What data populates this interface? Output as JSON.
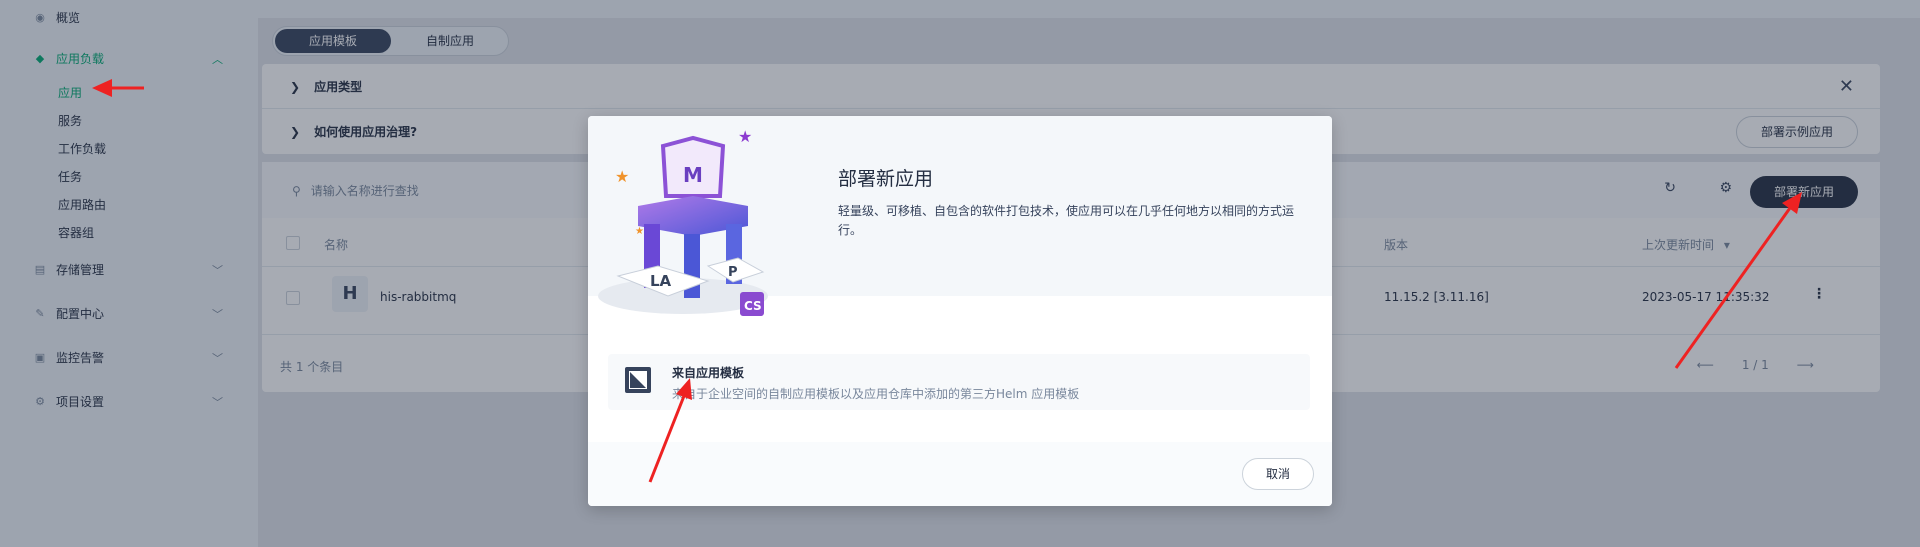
{
  "sidebar": {
    "overview": "概览",
    "workloads_group": "应用负载",
    "workloads_items": [
      "应用",
      "服务",
      "工作负载",
      "任务",
      "应用路由",
      "容器组"
    ],
    "storage": "存储管理",
    "config": "配置中心",
    "monitoring": "监控告警",
    "project_settings": "项目设置"
  },
  "tabs": {
    "templates": "应用模板",
    "custom": "自制应用"
  },
  "info": {
    "app_types": "应用类型",
    "how_to": "如何使用应用治理?",
    "sample_button": "部署示例应用"
  },
  "list": {
    "search_placeholder": "请输入名称进行查找",
    "deploy_button": "部署新应用",
    "col_name": "名称",
    "col_version": "版本",
    "col_updated": "上次更新时间",
    "rows": [
      {
        "avatar": "H",
        "name": "his-rabbitmq",
        "version": "11.15.2 [3.11.16]",
        "updated": "2023-05-17 11:35:32"
      }
    ],
    "total": "共 1 个条目",
    "page": "1 / 1"
  },
  "modal": {
    "title": "部署新应用",
    "description": "轻量级、可移植、自包含的软件打包技术，使应用可以在几乎任何地方以相同的方式运行。",
    "option_title": "来自应用模板",
    "option_desc": "来自于企业空间的自制应用模板以及应用仓库中添加的第三方Helm 应用模板",
    "cancel": "取消"
  },
  "icons": {
    "overview": "dashboard-icon",
    "workloads": "layers-icon",
    "storage": "database-icon",
    "config": "wrench-icon",
    "monitoring": "bell-icon",
    "project_settings": "gear-icon"
  },
  "colors": {
    "accent": "#00aa72",
    "primary_dark": "#242e42",
    "annotation_arrow": "#ee2222"
  }
}
